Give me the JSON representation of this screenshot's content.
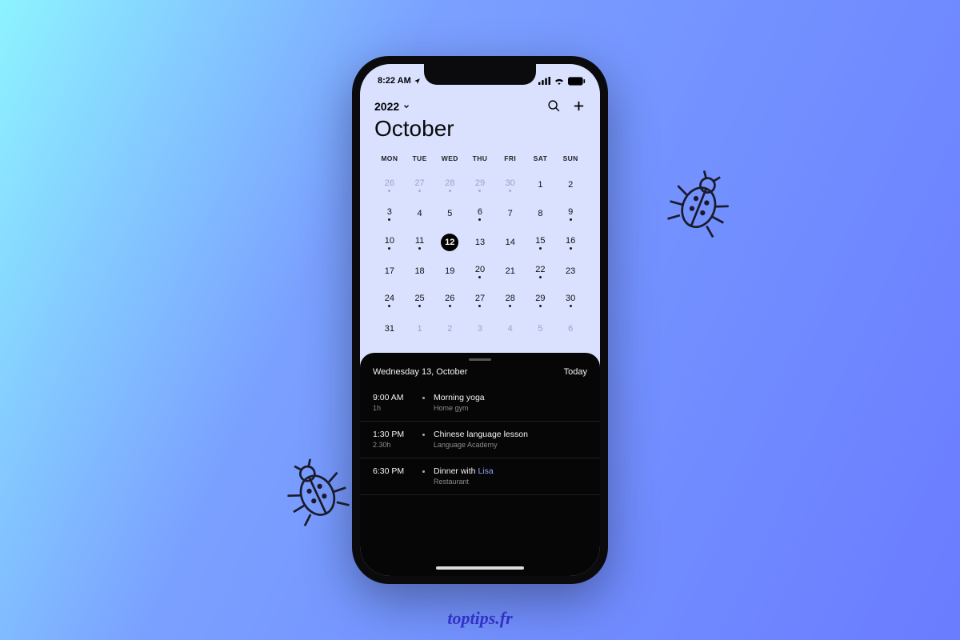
{
  "status": {
    "time": "8:22 AM"
  },
  "header": {
    "year": "2022",
    "month": "October"
  },
  "dow": [
    "MON",
    "TUE",
    "WED",
    "THU",
    "FRI",
    "SAT",
    "SUN"
  ],
  "grid": [
    [
      {
        "n": "26",
        "muted": true,
        "dot": true
      },
      {
        "n": "27",
        "muted": true,
        "dot": true
      },
      {
        "n": "28",
        "muted": true,
        "dot": true
      },
      {
        "n": "29",
        "muted": true,
        "dot": true
      },
      {
        "n": "30",
        "muted": true,
        "dot": true
      },
      {
        "n": "1",
        "muted": false,
        "dot": false
      },
      {
        "n": "2",
        "muted": false,
        "dot": false
      }
    ],
    [
      {
        "n": "3",
        "muted": false,
        "dot": true
      },
      {
        "n": "4",
        "muted": false,
        "dot": false
      },
      {
        "n": "5",
        "muted": false,
        "dot": false
      },
      {
        "n": "6",
        "muted": false,
        "dot": true
      },
      {
        "n": "7",
        "muted": false,
        "dot": false
      },
      {
        "n": "8",
        "muted": false,
        "dot": false
      },
      {
        "n": "9",
        "muted": false,
        "dot": true
      }
    ],
    [
      {
        "n": "10",
        "muted": false,
        "dot": true
      },
      {
        "n": "11",
        "muted": false,
        "dot": true
      },
      {
        "n": "12",
        "muted": false,
        "dot": false,
        "selected": true
      },
      {
        "n": "13",
        "muted": false,
        "dot": false
      },
      {
        "n": "14",
        "muted": false,
        "dot": false
      },
      {
        "n": "15",
        "muted": false,
        "dot": true
      },
      {
        "n": "16",
        "muted": false,
        "dot": true
      }
    ],
    [
      {
        "n": "17",
        "muted": false,
        "dot": false
      },
      {
        "n": "18",
        "muted": false,
        "dot": false
      },
      {
        "n": "19",
        "muted": false,
        "dot": false
      },
      {
        "n": "20",
        "muted": false,
        "dot": true
      },
      {
        "n": "21",
        "muted": false,
        "dot": false
      },
      {
        "n": "22",
        "muted": false,
        "dot": true
      },
      {
        "n": "23",
        "muted": false,
        "dot": false
      }
    ],
    [
      {
        "n": "24",
        "muted": false,
        "dot": true
      },
      {
        "n": "25",
        "muted": false,
        "dot": true
      },
      {
        "n": "26",
        "muted": false,
        "dot": true
      },
      {
        "n": "27",
        "muted": false,
        "dot": true
      },
      {
        "n": "28",
        "muted": false,
        "dot": true
      },
      {
        "n": "29",
        "muted": false,
        "dot": true
      },
      {
        "n": "30",
        "muted": false,
        "dot": true
      }
    ],
    [
      {
        "n": "31",
        "muted": false,
        "dot": false
      },
      {
        "n": "1",
        "muted": true,
        "dot": false
      },
      {
        "n": "2",
        "muted": true,
        "dot": false
      },
      {
        "n": "3",
        "muted": true,
        "dot": false
      },
      {
        "n": "4",
        "muted": true,
        "dot": false
      },
      {
        "n": "5",
        "muted": true,
        "dot": false
      },
      {
        "n": "6",
        "muted": true,
        "dot": false
      }
    ]
  ],
  "agenda": {
    "date": "Wednesday 13, October",
    "today_label": "Today",
    "events": [
      {
        "time": "9:00 AM",
        "duration": "1h",
        "title": "Morning yoga",
        "location": "Home gym"
      },
      {
        "time": "1:30 PM",
        "duration": "2.30h",
        "title": "Chinese language lesson",
        "location": "Language Academy"
      },
      {
        "time": "6:30 PM",
        "duration": "",
        "title": "Dinner with ",
        "highlight": "Lisa",
        "location": "Restaurant"
      }
    ]
  },
  "watermark": "toptips.fr"
}
